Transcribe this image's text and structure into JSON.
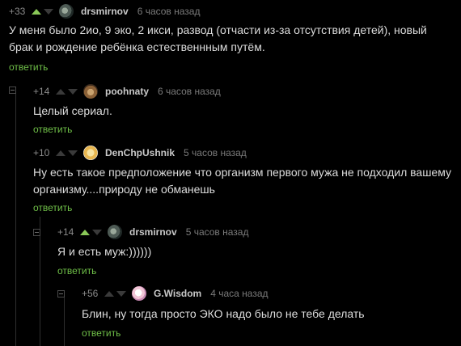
{
  "comments": [
    {
      "score": "+33",
      "username": "drsmirnov",
      "time": "6 часов назад",
      "text": "У меня было 2ио, 9 эко, 2 икси, развод (отчасти из-за отсутствия детей), новый брак и рождение ребёнка естественнным путём.",
      "reply": "ответить",
      "avatar": "drsmirnov-avatar"
    },
    {
      "score": "+14",
      "username": "poohnaty",
      "time": "6 часов назад",
      "text": "Целый сериал.",
      "reply": "ответить",
      "avatar": "poohnaty-avatar"
    },
    {
      "score": "+10",
      "username": "DenChpUshnik",
      "time": "5 часов назад",
      "text": "Ну есть такое предположение что организм первого мужа не подходил вашему организму....природу не обманешь",
      "reply": "ответить",
      "avatar": "denchpushnik-avatar"
    },
    {
      "score": "+14",
      "username": "drsmirnov",
      "time": "5 часов назад",
      "text": "Я и есть муж:))))))",
      "reply": "ответить",
      "avatar": "drsmirnov-avatar"
    },
    {
      "score": "+56",
      "username": "G.Wisdom",
      "time": "4 часа назад",
      "text": "Блин, ну тогда просто ЭКО надо было не тебе делать",
      "reply": "ответить",
      "avatar": "gwisdom-avatar"
    }
  ],
  "colors": {
    "background": "#000000",
    "reply_link": "#6fbf48",
    "upvote": "#8ac858"
  }
}
